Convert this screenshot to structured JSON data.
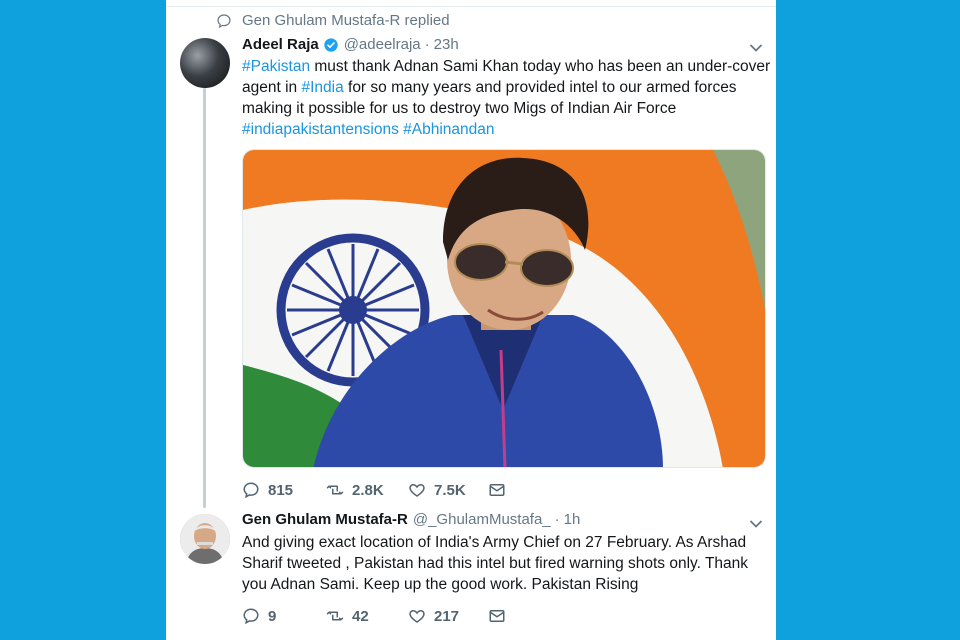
{
  "colors": {
    "background": "#0ea1de",
    "link": "#1b95e0",
    "muted": "#657786",
    "verified": "#1da1f2"
  },
  "reply_context": {
    "text": "Gen Ghulam Mustafa-R replied"
  },
  "tweet1": {
    "name": "Adeel Raja",
    "handle": "@adeelraja",
    "separator": "·",
    "time": "23h",
    "text_parts": [
      "#Pakistan",
      " must thank Adnan Sami Khan today who has been an under-cover agent in ",
      "#India",
      " for so many years and provided intel to our armed forces making it possible for us to destroy two Migs of Indian Air Force ",
      "#indiapakistantensions",
      " ",
      "#Abhinandan"
    ],
    "counts": {
      "reply": "815",
      "retweet": "2.8K",
      "like": "7.5K"
    }
  },
  "tweet2": {
    "name": "Gen Ghulam Mustafa-R",
    "handle": "@_GhulamMustafa_",
    "separator": "·",
    "time": "1h",
    "text": "And giving exact location of India's Army Chief on 27 February. As Arshad Sharif tweeted , Pakistan had this intel but fired warning shots only. Thank you Adnan Sami. Keep up the good work. Pakistan Rising",
    "counts": {
      "reply": "9",
      "retweet": "42",
      "like": "217"
    }
  },
  "icons": [
    "reply-icon",
    "retweet-icon",
    "like-icon",
    "message-icon",
    "chevron-down-icon",
    "verified-icon"
  ]
}
